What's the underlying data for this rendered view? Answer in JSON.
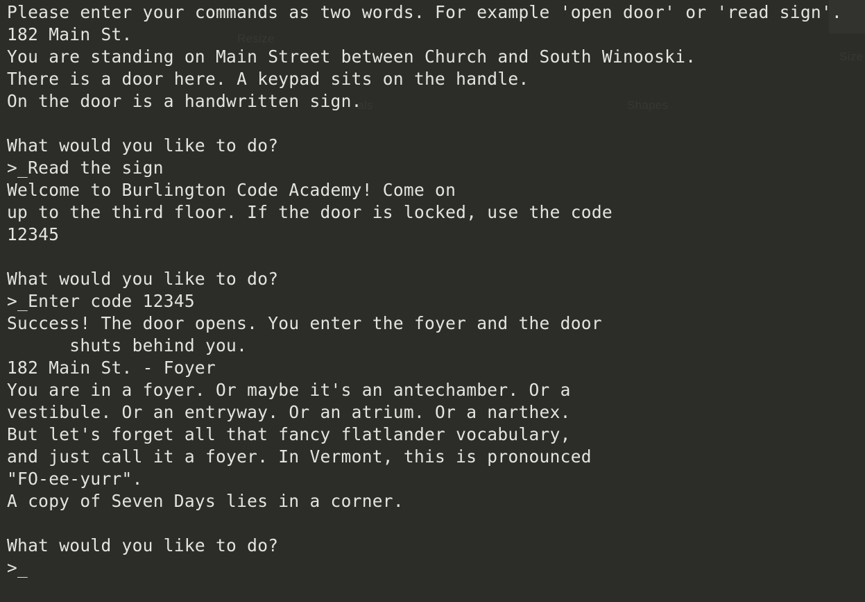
{
  "terminal": {
    "lines": [
      "Please enter your commands as two words. For example 'open door' or 'read sign'.",
      "182 Main St.",
      "You are standing on Main Street between Church and South Winooski.",
      "There is a door here. A keypad sits on the handle.",
      "On the door is a handwritten sign.",
      "",
      "What would you like to do?",
      ">_Read the sign",
      "Welcome to Burlington Code Academy! Come on",
      "up to the third floor. If the door is locked, use the code",
      "12345",
      "",
      "What would you like to do?",
      ">_Enter code 12345",
      "Success! The door opens. You enter the foyer and the door",
      "      shuts behind you.",
      "182 Main St. - Foyer",
      "You are in a foyer. Or maybe it's an antechamber. Or a",
      "vestibule. Or an entryway. Or an atrium. Or a narthex.",
      "But let's forget all that fancy flatlander vocabulary,",
      "and just call it a foyer. In Vermont, this is pronounced",
      "\"FO-ee-yurr\".",
      "A copy of Seven Days lies in a corner.",
      "",
      "What would you like to do?"
    ],
    "prompt": ">_",
    "input_value": ""
  },
  "background_ghost": {
    "resize_label": "Resize",
    "shapes_label": "Shapes",
    "size_label": "Size",
    "als_label": "als"
  },
  "colors": {
    "background": "#2c2c28",
    "text": "#e4e4df"
  }
}
